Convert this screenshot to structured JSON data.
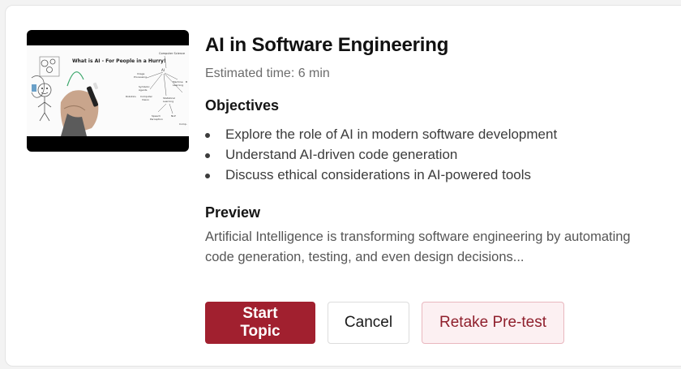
{
  "topic": {
    "title": "AI in Software Engineering",
    "estimated_time": "Estimated time: 6 min",
    "thumbnail": {
      "caption": "What is AI - For People in a Hurry!",
      "icon": "video-thumbnail-whiteboard-drawing"
    }
  },
  "objectives": {
    "heading": "Objectives",
    "items": [
      "Explore the role of AI in modern software development",
      "Understand AI-driven code generation",
      "Discuss ethical considerations in AI-powered tools"
    ]
  },
  "preview": {
    "heading": "Preview",
    "text": "Artificial Intelligence is transforming software engineering by automating code generation, testing, and even design decisions..."
  },
  "actions": {
    "start_label": "Start Topic",
    "cancel_label": "Cancel",
    "retake_label": "Retake Pre-test"
  },
  "colors": {
    "primary": "#a1202f",
    "secondary_bg": "#fcf0f2",
    "secondary_text": "#8f1f2c"
  }
}
